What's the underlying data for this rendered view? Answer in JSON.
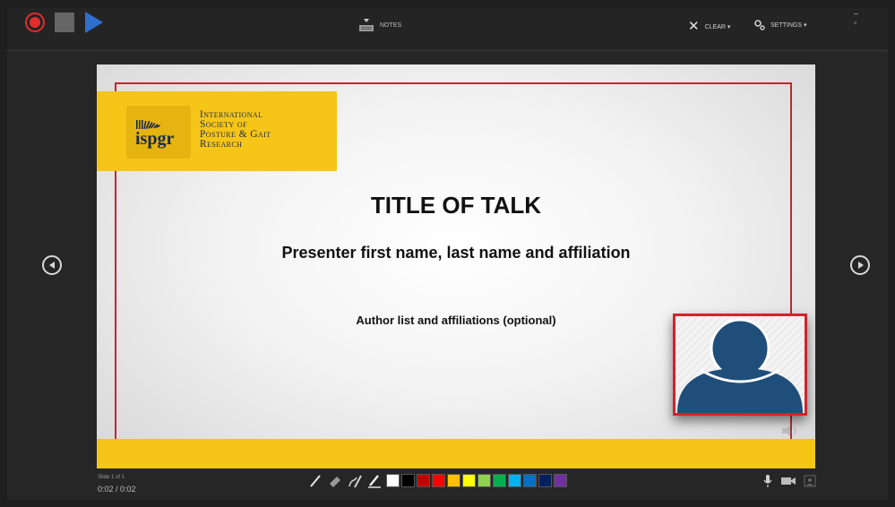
{
  "toolbar": {
    "notes_label": "NOTES",
    "clear_label": "CLEAR ▾",
    "settings_label": "SETTINGS ▾",
    "window_controls": "– ▫"
  },
  "slide": {
    "logo_short": "ispgr",
    "logo_lines": [
      "International",
      "Society of",
      "Posture & Gait",
      "Research"
    ],
    "title": "TITLE OF TALK",
    "presenter": "Presenter first name, last name and affiliation",
    "authors": "Author list and affiliations (optional)"
  },
  "status": {
    "slide_count": "Slide 1 of 1",
    "time": "0:02 / 0:02"
  },
  "colors": {
    "record": "#e32d2d",
    "play": "#2f6fd0",
    "slide_accent": "#f5c518",
    "slide_border": "#c1272d",
    "avatar": "#1f4e7a"
  },
  "pen_swatches": [
    "#ffffff",
    "#000000",
    "#c00000",
    "#ff0000",
    "#ffc000",
    "#ffff00",
    "#92d050",
    "#00b050",
    "#00b0f0",
    "#0070c0",
    "#002060",
    "#7030a0"
  ]
}
